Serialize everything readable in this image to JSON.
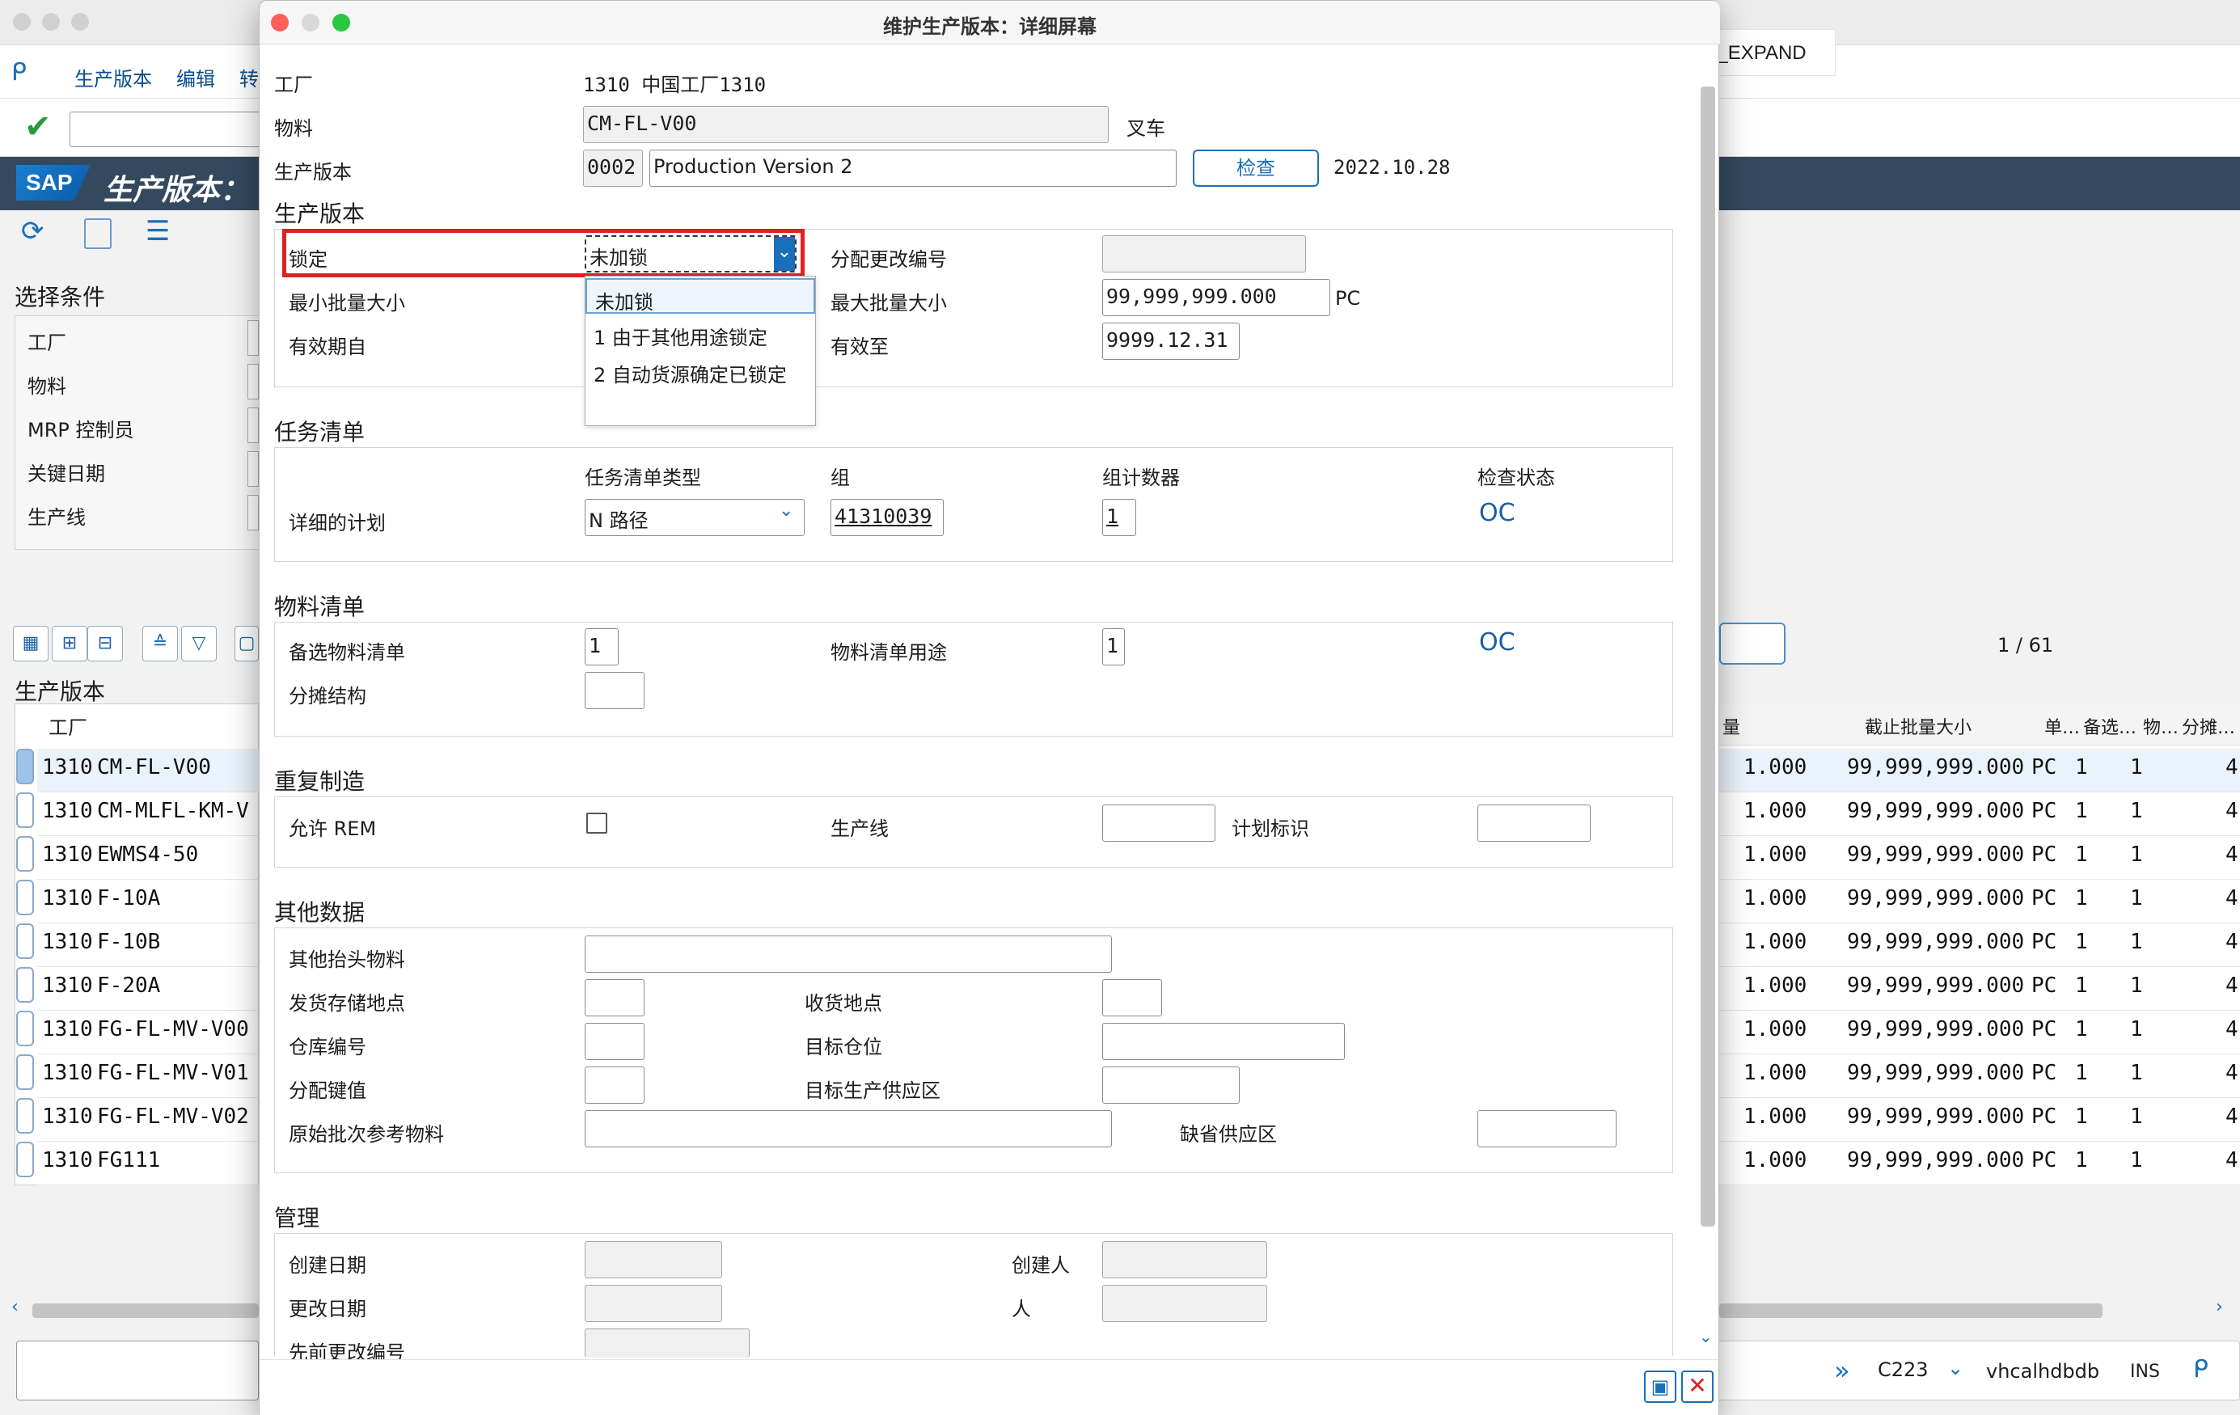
{
  "bg": {
    "menu": [
      "生产版本",
      "编辑",
      "转"
    ],
    "title": "生产版本：",
    "sap_logo": "SAP",
    "selection_title": "选择条件",
    "selection_fields": [
      "工厂",
      "物料",
      "MRP 控制员",
      "关键日期",
      "生产线"
    ],
    "grid_title": "生产版本",
    "grid_col_plant": "工厂",
    "rows": [
      {
        "plant": "1310",
        "material": "CM-FL-V00"
      },
      {
        "plant": "1310",
        "material": "CM-MLFL-KM-V"
      },
      {
        "plant": "1310",
        "material": "EWMS4-50"
      },
      {
        "plant": "1310",
        "material": "F-10A"
      },
      {
        "plant": "1310",
        "material": "F-10B"
      },
      {
        "plant": "1310",
        "material": "F-20A"
      },
      {
        "plant": "1310",
        "material": "FG-FL-MV-V00"
      },
      {
        "plant": "1310",
        "material": "FG-FL-MV-V01"
      },
      {
        "plant": "1310",
        "material": "FG-FL-MV-V02"
      },
      {
        "plant": "1310",
        "material": "FG111"
      }
    ],
    "right_header": {
      "h1": "量",
      "h2": "截止批量大小",
      "h3": "单…",
      "h4": "备选…",
      "h5": "物…",
      "h6": "分摊…"
    },
    "right_row": {
      "lot_min": "1.000",
      "lot_max": "99,999,999.000",
      "unit": "PC",
      "alt": "1",
      "bom": "1",
      "last": "4"
    },
    "page_counter": "1 /  61",
    "status": {
      "system": "C223",
      "host": "vhcalhdbdb",
      "mode": "INS"
    }
  },
  "tooltip": "MKAL_EXPAND",
  "dialog": {
    "title": "维护生产版本：详细屏幕",
    "header": {
      "plant_label": "工厂",
      "plant_value": "1310  中国工厂1310",
      "material_label": "物料",
      "material_value": "CM-FL-V00",
      "material_desc": "叉车",
      "version_label": "生产版本",
      "version_value": "0002",
      "version_desc": "Production Version 2",
      "check_button": "检查",
      "date": "2022.10.28"
    },
    "prod_version": {
      "title": "生产版本",
      "lock_label": "锁定",
      "lock_value": "未加锁",
      "change_no_label": "分配更改编号",
      "change_no_value": "",
      "min_lot_label": "最小批量大小",
      "max_lot_label": "最大批量大小",
      "max_lot_value": "99,999,999.000",
      "max_lot_unit": "PC",
      "valid_from_label": "有效期自",
      "valid_to_label": "有效至",
      "valid_to_value": "9999.12.31",
      "dropdown_options": [
        "未加锁",
        "1  由于其他用途锁定",
        "2  自动货源确定已锁定"
      ]
    },
    "routing": {
      "title": "任务清单",
      "type_header": "任务清单类型",
      "group_header": "组",
      "counter_header": "组计数器",
      "status_header": "检查状态",
      "row_label": "详细的计划",
      "type_value": "N  路径",
      "group_value": "41310039",
      "counter_value": "1",
      "status_icon": "OC"
    },
    "bom": {
      "title": "物料清单",
      "alt_label": "备选物料清单",
      "alt_value": "1",
      "usage_label": "物料清单用途",
      "usage_value": "1",
      "apportion_label": "分摊结构",
      "status_icon": "OC"
    },
    "rem": {
      "title": "重复制造",
      "allow_label": "允许 REM",
      "line_label": "生产线",
      "plan_id_label": "计划标识"
    },
    "other": {
      "title": "其他数据",
      "other_header_label": "其他抬头物料",
      "issue_sloc_label": "发货存储地点",
      "receive_label": "收货地点",
      "warehouse_label": "仓库编号",
      "target_bin_label": "目标仓位",
      "distribution_label": "分配键值",
      "target_supply_label": "目标生产供应区",
      "orig_batch_label": "原始批次参考物料",
      "default_supply_label": "缺省供应区"
    },
    "admin": {
      "title": "管理",
      "created_on_label": "创建日期",
      "created_by_label": "创建人",
      "changed_on_label": "更改日期",
      "changed_by_label": "人",
      "prev_change_label": "先前更改编号"
    }
  },
  "colors": {
    "sap_header": "#34495e",
    "link_blue": "#1a6fb8",
    "highlight_red": "#e02020"
  }
}
